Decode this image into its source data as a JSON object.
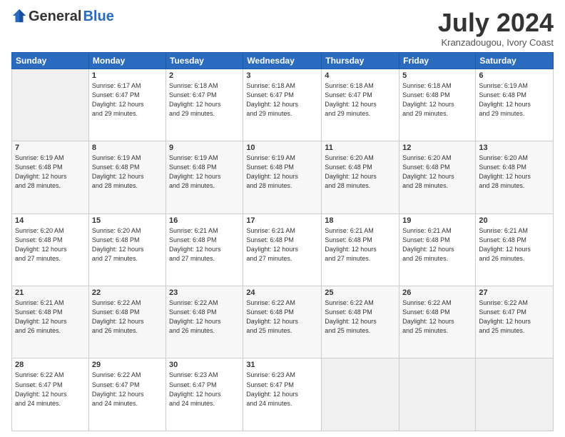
{
  "header": {
    "logo_general": "General",
    "logo_blue": "Blue",
    "title": "July 2024",
    "location": "Kranzadougou, Ivory Coast"
  },
  "days_header": [
    "Sunday",
    "Monday",
    "Tuesday",
    "Wednesday",
    "Thursday",
    "Friday",
    "Saturday"
  ],
  "weeks": [
    [
      {
        "num": "",
        "info": ""
      },
      {
        "num": "1",
        "info": "Sunrise: 6:17 AM\nSunset: 6:47 PM\nDaylight: 12 hours\nand 29 minutes."
      },
      {
        "num": "2",
        "info": "Sunrise: 6:18 AM\nSunset: 6:47 PM\nDaylight: 12 hours\nand 29 minutes."
      },
      {
        "num": "3",
        "info": "Sunrise: 6:18 AM\nSunset: 6:47 PM\nDaylight: 12 hours\nand 29 minutes."
      },
      {
        "num": "4",
        "info": "Sunrise: 6:18 AM\nSunset: 6:47 PM\nDaylight: 12 hours\nand 29 minutes."
      },
      {
        "num": "5",
        "info": "Sunrise: 6:18 AM\nSunset: 6:48 PM\nDaylight: 12 hours\nand 29 minutes."
      },
      {
        "num": "6",
        "info": "Sunrise: 6:19 AM\nSunset: 6:48 PM\nDaylight: 12 hours\nand 29 minutes."
      }
    ],
    [
      {
        "num": "7",
        "info": "Sunrise: 6:19 AM\nSunset: 6:48 PM\nDaylight: 12 hours\nand 28 minutes."
      },
      {
        "num": "8",
        "info": "Sunrise: 6:19 AM\nSunset: 6:48 PM\nDaylight: 12 hours\nand 28 minutes."
      },
      {
        "num": "9",
        "info": "Sunrise: 6:19 AM\nSunset: 6:48 PM\nDaylight: 12 hours\nand 28 minutes."
      },
      {
        "num": "10",
        "info": "Sunrise: 6:19 AM\nSunset: 6:48 PM\nDaylight: 12 hours\nand 28 minutes."
      },
      {
        "num": "11",
        "info": "Sunrise: 6:20 AM\nSunset: 6:48 PM\nDaylight: 12 hours\nand 28 minutes."
      },
      {
        "num": "12",
        "info": "Sunrise: 6:20 AM\nSunset: 6:48 PM\nDaylight: 12 hours\nand 28 minutes."
      },
      {
        "num": "13",
        "info": "Sunrise: 6:20 AM\nSunset: 6:48 PM\nDaylight: 12 hours\nand 28 minutes."
      }
    ],
    [
      {
        "num": "14",
        "info": "Sunrise: 6:20 AM\nSunset: 6:48 PM\nDaylight: 12 hours\nand 27 minutes."
      },
      {
        "num": "15",
        "info": "Sunrise: 6:20 AM\nSunset: 6:48 PM\nDaylight: 12 hours\nand 27 minutes."
      },
      {
        "num": "16",
        "info": "Sunrise: 6:21 AM\nSunset: 6:48 PM\nDaylight: 12 hours\nand 27 minutes."
      },
      {
        "num": "17",
        "info": "Sunrise: 6:21 AM\nSunset: 6:48 PM\nDaylight: 12 hours\nand 27 minutes."
      },
      {
        "num": "18",
        "info": "Sunrise: 6:21 AM\nSunset: 6:48 PM\nDaylight: 12 hours\nand 27 minutes."
      },
      {
        "num": "19",
        "info": "Sunrise: 6:21 AM\nSunset: 6:48 PM\nDaylight: 12 hours\nand 26 minutes."
      },
      {
        "num": "20",
        "info": "Sunrise: 6:21 AM\nSunset: 6:48 PM\nDaylight: 12 hours\nand 26 minutes."
      }
    ],
    [
      {
        "num": "21",
        "info": "Sunrise: 6:21 AM\nSunset: 6:48 PM\nDaylight: 12 hours\nand 26 minutes."
      },
      {
        "num": "22",
        "info": "Sunrise: 6:22 AM\nSunset: 6:48 PM\nDaylight: 12 hours\nand 26 minutes."
      },
      {
        "num": "23",
        "info": "Sunrise: 6:22 AM\nSunset: 6:48 PM\nDaylight: 12 hours\nand 26 minutes."
      },
      {
        "num": "24",
        "info": "Sunrise: 6:22 AM\nSunset: 6:48 PM\nDaylight: 12 hours\nand 25 minutes."
      },
      {
        "num": "25",
        "info": "Sunrise: 6:22 AM\nSunset: 6:48 PM\nDaylight: 12 hours\nand 25 minutes."
      },
      {
        "num": "26",
        "info": "Sunrise: 6:22 AM\nSunset: 6:48 PM\nDaylight: 12 hours\nand 25 minutes."
      },
      {
        "num": "27",
        "info": "Sunrise: 6:22 AM\nSunset: 6:47 PM\nDaylight: 12 hours\nand 25 minutes."
      }
    ],
    [
      {
        "num": "28",
        "info": "Sunrise: 6:22 AM\nSunset: 6:47 PM\nDaylight: 12 hours\nand 24 minutes."
      },
      {
        "num": "29",
        "info": "Sunrise: 6:22 AM\nSunset: 6:47 PM\nDaylight: 12 hours\nand 24 minutes."
      },
      {
        "num": "30",
        "info": "Sunrise: 6:23 AM\nSunset: 6:47 PM\nDaylight: 12 hours\nand 24 minutes."
      },
      {
        "num": "31",
        "info": "Sunrise: 6:23 AM\nSunset: 6:47 PM\nDaylight: 12 hours\nand 24 minutes."
      },
      {
        "num": "",
        "info": ""
      },
      {
        "num": "",
        "info": ""
      },
      {
        "num": "",
        "info": ""
      }
    ]
  ]
}
